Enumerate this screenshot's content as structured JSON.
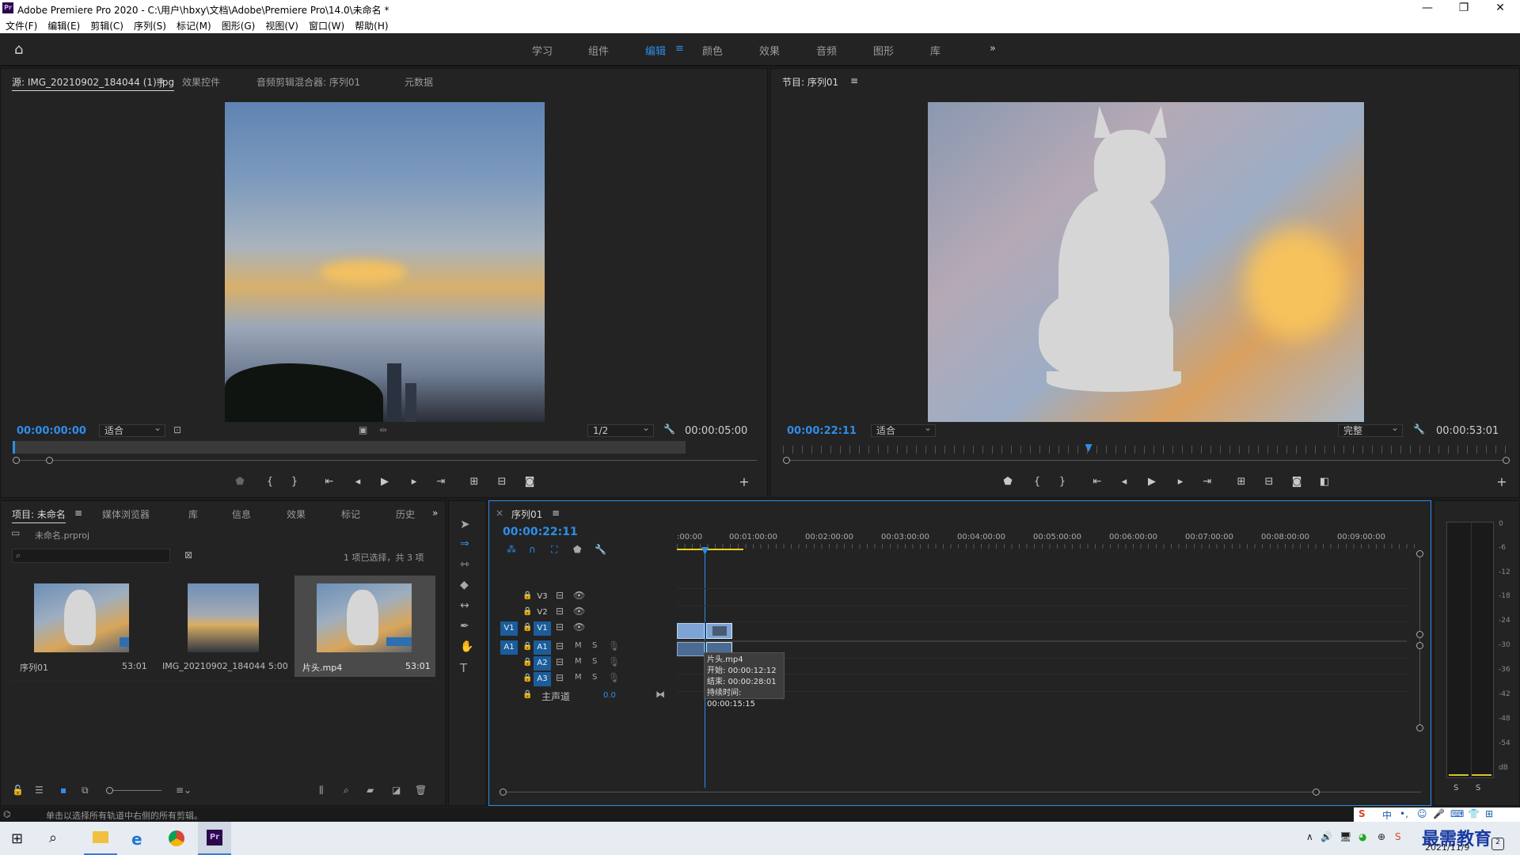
{
  "window": {
    "title": "Adobe Premiere Pro 2020 - C:\\用户\\hbxy\\文档\\Adobe\\Premiere Pro\\14.0\\未命名 *",
    "app_badge": "Pr"
  },
  "menu": [
    "文件(F)",
    "编辑(E)",
    "剪辑(C)",
    "序列(S)",
    "标记(M)",
    "图形(G)",
    "视图(V)",
    "窗口(W)",
    "帮助(H)"
  ],
  "workspaces": [
    "学习",
    "组件",
    "编辑",
    "颜色",
    "效果",
    "音频",
    "图形",
    "库"
  ],
  "workspace_active": "编辑",
  "source_panel": {
    "tabs": [
      "源: IMG_20210902_184044 (1).jpg",
      "效果控件",
      "音频剪辑混合器: 序列01",
      "元数据"
    ],
    "timecode": "00:00:00:00",
    "fit": "适合",
    "resolution": "1/2",
    "duration": "00:00:05:00",
    "playhead_progress": 0
  },
  "program_panel": {
    "tab": "节目: 序列01",
    "timecode": "00:00:22:11",
    "fit": "适合",
    "quality": "完整",
    "duration": "00:00:53:01",
    "playhead_progress": 0.42
  },
  "project_panel": {
    "tabs": [
      "项目: 未命名",
      "媒体浏览器",
      "库",
      "信息",
      "效果",
      "标记",
      "历史"
    ],
    "file": "未命名.prproj",
    "selection_info": "1 项已选择，共 3 项",
    "items": [
      {
        "name": "序列01",
        "duration": "53:01"
      },
      {
        "name": "IMG_20210902_184044 ...",
        "duration": "5:00"
      },
      {
        "name": "片头.mp4",
        "duration": "53:01"
      }
    ]
  },
  "timeline": {
    "tab": "序列01",
    "timecode": "00:00:22:11",
    "ruler": [
      ":00:00",
      "00:01:00:00",
      "00:02:00:00",
      "00:03:00:00",
      "00:04:00:00",
      "00:05:00:00",
      "00:06:00:00",
      "00:07:00:00",
      "00:08:00:00",
      "00:09:00:00"
    ],
    "video_tracks": [
      "V3",
      "V2",
      "V1"
    ],
    "audio_tracks": [
      "A1",
      "A2",
      "A3"
    ],
    "source_v": "V1",
    "source_a": "A1",
    "mute_label": "M",
    "solo_label": "S",
    "master": {
      "label": "主声道",
      "value": "0.0"
    },
    "tooltip": {
      "name": "片头.mp4",
      "start": "开始: 00:00:12:12",
      "end": "结束: 00:00:28:01",
      "duration": "持续时间: 00:00:15:15"
    }
  },
  "meter": {
    "scale": [
      "0",
      "-6",
      "-12",
      "-18",
      "-24",
      "-30",
      "-36",
      "-42",
      "-48",
      "-54",
      "dB"
    ],
    "solo": [
      "S",
      "S"
    ]
  },
  "status_bar": "单击以选择所有轨道中右侧的所有剪辑。",
  "taskbar": {
    "date": "2021/11/9",
    "watermark": "最需教育",
    "ime": "中"
  },
  "colors": {
    "accent": "#2e8ee8",
    "panel": "#232323",
    "bg": "#1d1d1d",
    "track_blue": "#1b5d9a"
  }
}
